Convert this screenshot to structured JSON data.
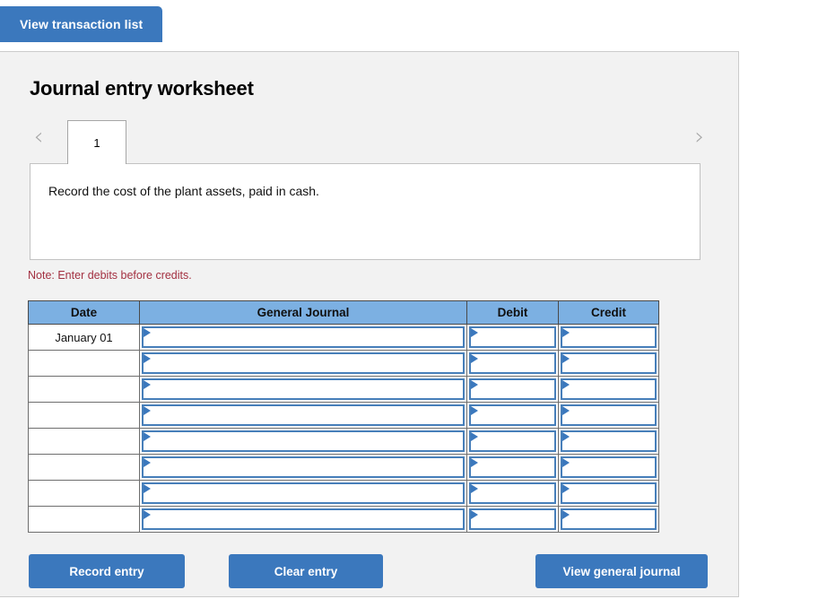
{
  "top_bar": {
    "view_transaction_list_label": "View transaction list"
  },
  "panel": {
    "title": "Journal entry worksheet",
    "pager": {
      "prev_icon": "chevron-left-icon",
      "next_icon": "chevron-right-icon",
      "tabs": [
        {
          "label": "1",
          "active": true
        }
      ]
    },
    "instruction": "Record the cost of the plant assets, paid in cash.",
    "note": "Note: Enter debits before credits."
  },
  "journal_table": {
    "columns": [
      "Date",
      "General Journal",
      "Debit",
      "Credit"
    ],
    "rows": [
      {
        "date": "January 01",
        "journal": "",
        "debit": "",
        "credit": ""
      },
      {
        "date": "",
        "journal": "",
        "debit": "",
        "credit": ""
      },
      {
        "date": "",
        "journal": "",
        "debit": "",
        "credit": ""
      },
      {
        "date": "",
        "journal": "",
        "debit": "",
        "credit": ""
      },
      {
        "date": "",
        "journal": "",
        "debit": "",
        "credit": ""
      },
      {
        "date": "",
        "journal": "",
        "debit": "",
        "credit": ""
      },
      {
        "date": "",
        "journal": "",
        "debit": "",
        "credit": ""
      },
      {
        "date": "",
        "journal": "",
        "debit": "",
        "credit": ""
      }
    ]
  },
  "actions": {
    "record_entry_label": "Record entry",
    "clear_entry_label": "Clear entry",
    "view_general_journal_label": "View general journal"
  },
  "colors": {
    "button_blue": "#3b78bd",
    "header_blue": "#7cb0e2",
    "input_border_blue": "#477fba",
    "panel_bg": "#f2f2f2",
    "note_red": "#a33041"
  }
}
